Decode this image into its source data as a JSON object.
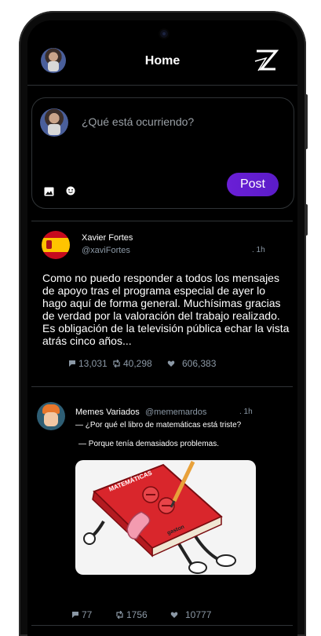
{
  "header": {
    "title": "Home"
  },
  "composer": {
    "placeholder": "¿Qué está ocurriendo?",
    "post_label": "Post"
  },
  "tweets": [
    {
      "name": "Xavier Fortes",
      "handle": "@xaviFortes",
      "time": ". 1h",
      "text": "Como no puedo responder a todos los mensajes de apoyo tras el programa especial de ayer lo hago aquí de forma general. Muchísimas gracias de verdad por la valoración del trabajo realizado. Es obligación de la televisión pública echar la vista atrás cinco años...",
      "replies": "13,031",
      "retweets": "40,298",
      "likes": "606,383"
    },
    {
      "name": "Memes Variados",
      "handle": "@mememardos",
      "time": ". 1h",
      "line1": "— ¿Por qué el libro de matemáticas está triste?",
      "line2": "— Porque tenía demasiados problemas.",
      "meme_title": "MATEMÁTICAS",
      "meme_signature": "gaston",
      "replies": "77",
      "retweets": "1756",
      "likes": "10777"
    }
  ],
  "colors": {
    "background": "#000000",
    "accent": "#6a1fd6",
    "secondary_text": "#8b98a5",
    "divider": "#2f3336"
  }
}
